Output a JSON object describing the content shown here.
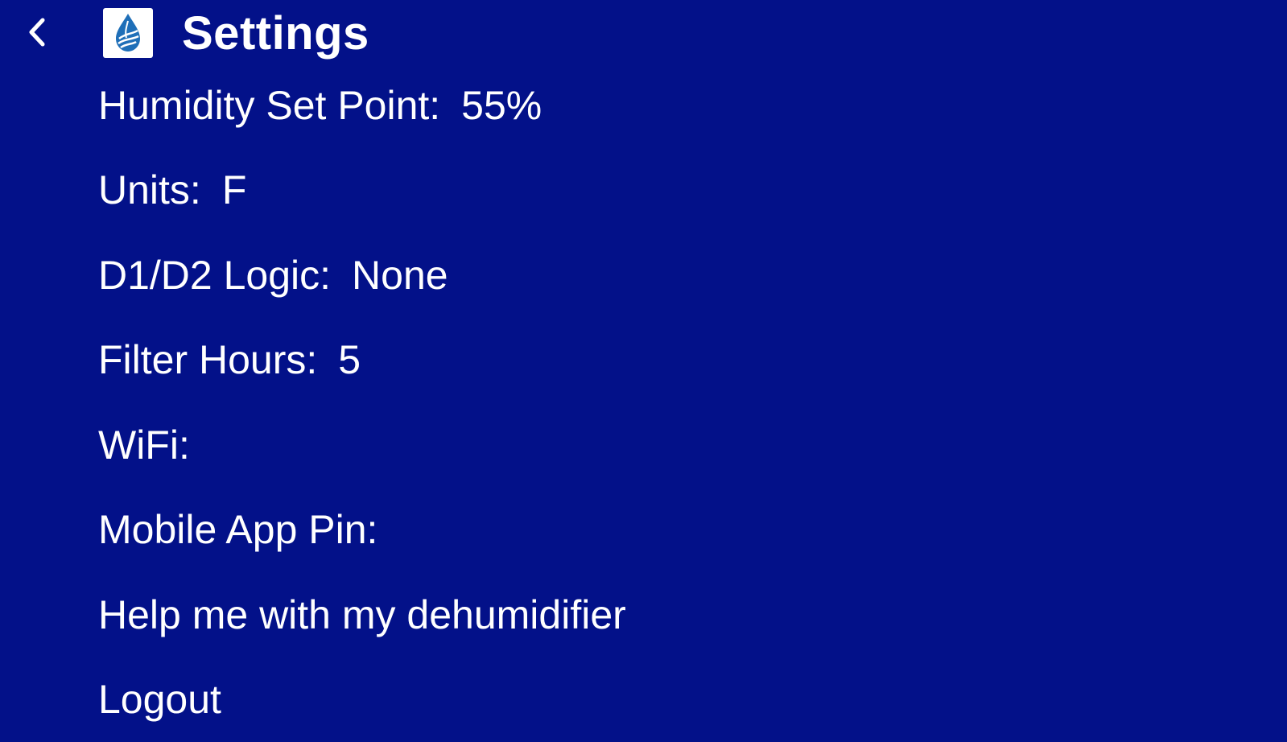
{
  "header": {
    "back_icon": "chevron-left-icon",
    "logo_icon": "water-drop-logo-icon",
    "title": "Settings"
  },
  "colors": {
    "background": "#031189",
    "text": "#ffffff",
    "logo_blue": "#1f6fb8"
  },
  "settings": {
    "humidity_label": "Humidity Set Point:",
    "humidity_value": "55%",
    "units_label": "Units:",
    "units_value": "F",
    "logic_label": "D1/D2 Logic:",
    "logic_value": "None",
    "filter_label": "Filter Hours:",
    "filter_value": "5",
    "wifi_label": "WiFi:",
    "pin_label": "Mobile App Pin:",
    "help_label": "Help me with my dehumidifier",
    "logout_label": "Logout"
  }
}
